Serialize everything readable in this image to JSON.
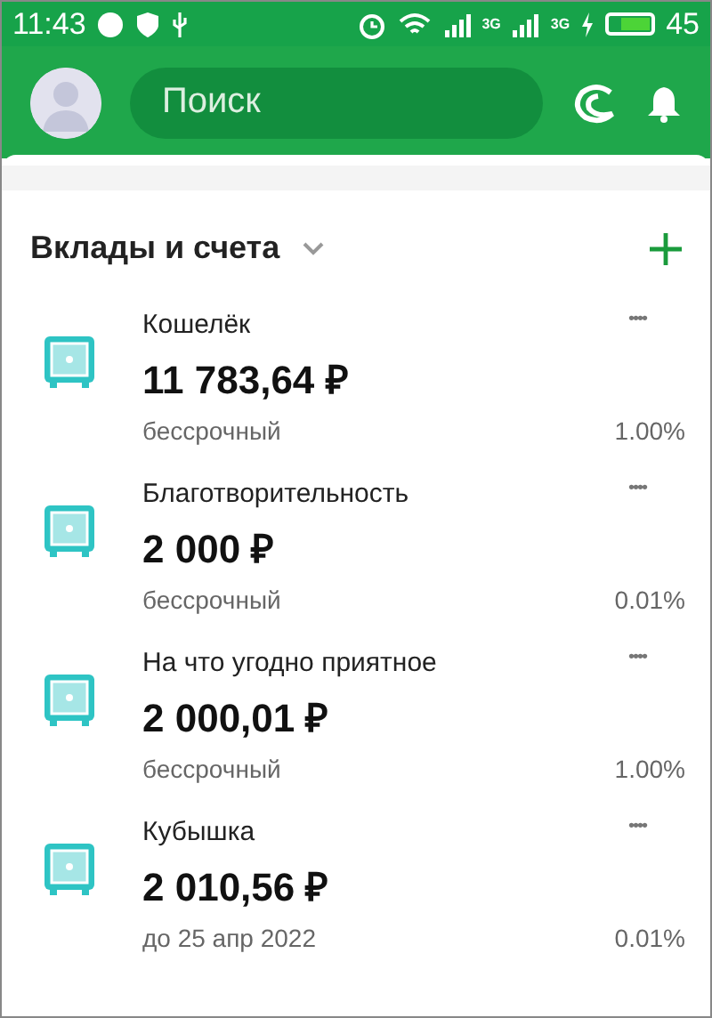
{
  "status_bar": {
    "time": "11:43",
    "network_1": "3G",
    "network_2": "3G",
    "battery_percent": "45"
  },
  "header": {
    "search": {
      "placeholder": "Поиск"
    }
  },
  "section": {
    "title": "Вклады и счета",
    "expanded": false
  },
  "accounts": [
    {
      "name": "Кошелёк",
      "amount": "11 783,64 ₽",
      "term": "бессрочный",
      "rate": "1.00%",
      "masked": "••••"
    },
    {
      "name": "Благотворительность",
      "amount": "2 000 ₽",
      "term": "бессрочный",
      "rate": "0.01%",
      "masked": "••••"
    },
    {
      "name": "На что угодно приятное",
      "amount": "2 000,01 ₽",
      "term": "бессрочный",
      "rate": "1.00%",
      "masked": "••••"
    },
    {
      "name": "Кубышка",
      "amount": "2 010,56 ₽",
      "term": "до 25 апр 2022",
      "rate": "0.01%",
      "masked": "••••"
    }
  ]
}
